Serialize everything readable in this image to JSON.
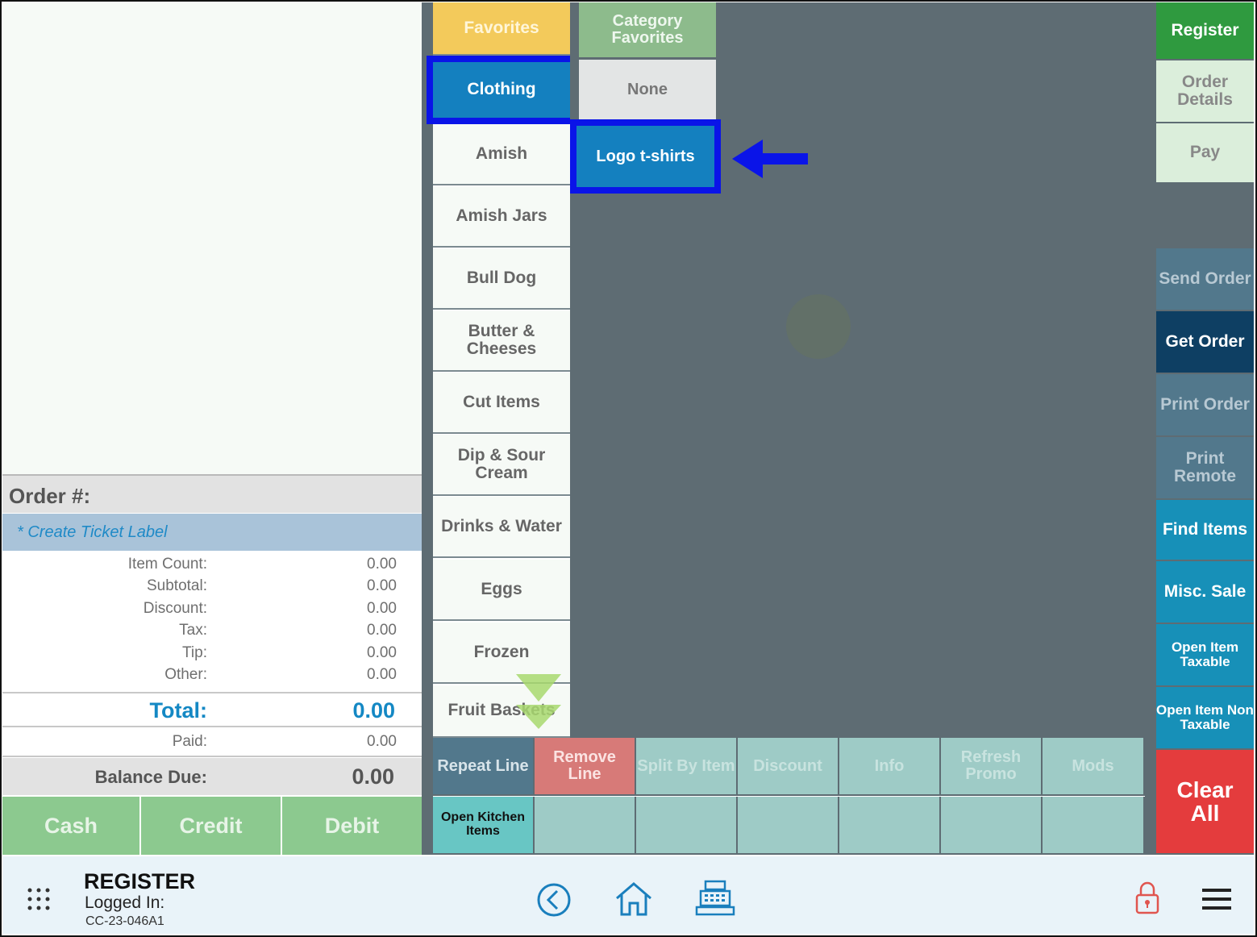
{
  "order": {
    "order_number_label": "Order #:",
    "ticket_label": "* Create Ticket Label",
    "summary": [
      {
        "label": "Item Count:",
        "value": "0.00"
      },
      {
        "label": "Subtotal:",
        "value": "0.00"
      },
      {
        "label": "Discount:",
        "value": "0.00"
      },
      {
        "label": "Tax:",
        "value": "0.00"
      },
      {
        "label": "Tip:",
        "value": "0.00"
      },
      {
        "label": "Other:",
        "value": "0.00"
      }
    ],
    "total_label": "Total:",
    "total_value": "0.00",
    "paid_label": "Paid:",
    "paid_value": "0.00",
    "balance_label": "Balance Due:",
    "balance_value": "0.00"
  },
  "payment_buttons": [
    "Cash",
    "Credit",
    "Debit"
  ],
  "categories": [
    {
      "label": "Favorites",
      "state": "favorites"
    },
    {
      "label": "Clothing",
      "state": "selected"
    },
    {
      "label": "Amish"
    },
    {
      "label": "Amish Jars"
    },
    {
      "label": "Bull Dog"
    },
    {
      "label": "Butter & Cheeses"
    },
    {
      "label": "Cut Items"
    },
    {
      "label": "Dip & Sour Cream"
    },
    {
      "label": "Drinks & Water"
    },
    {
      "label": "Eggs"
    },
    {
      "label": "Frozen"
    },
    {
      "label": "Fruit Baskets"
    }
  ],
  "subcategories": [
    {
      "label": "Category Favorites"
    },
    {
      "label": "None"
    },
    {
      "label": "Logo t-shirts",
      "state": "selected"
    }
  ],
  "right_buttons": [
    {
      "label": "Register"
    },
    {
      "label": "Order Details"
    },
    {
      "label": "Pay"
    },
    {
      "label": "Send Order"
    },
    {
      "label": "Get Order"
    },
    {
      "label": "Print Order"
    },
    {
      "label": "Print Remote"
    },
    {
      "label": "Find Items"
    },
    {
      "label": "Misc. Sale"
    },
    {
      "label": "Open Item Taxable"
    },
    {
      "label": "Open Item Non Taxable"
    },
    {
      "label": "Clear All"
    }
  ],
  "action_row": [
    "Repeat Line",
    "Remove Line",
    "Split By Item",
    "Discount",
    "Info",
    "Refresh Promo",
    "Mods"
  ],
  "action_row2": [
    "Open Kitchen Items"
  ],
  "footer": {
    "title": "REGISTER",
    "logged_in": "Logged In:",
    "device_id": "CC-23-046A1"
  },
  "colors": {
    "highlight": "#0a14e8",
    "selected": "#1480bf",
    "favorites": "#f3ca5b",
    "danger": "#e43c3d"
  }
}
